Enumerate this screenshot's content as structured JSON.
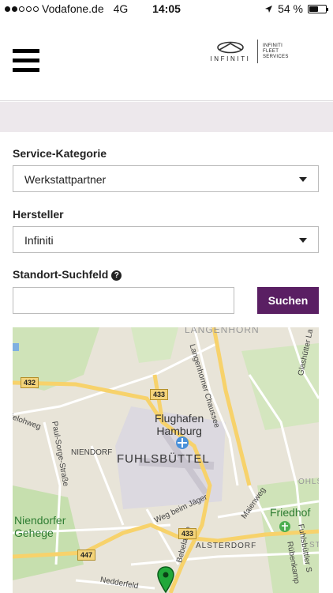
{
  "status_bar": {
    "carrier": "Vodafone.de",
    "network": "4G",
    "time": "14:05",
    "battery": "54 %",
    "battery_level": 0.54,
    "signal_bars": 2
  },
  "header": {
    "logo_brand": "INFINITI",
    "logo_text": [
      "INFINITI",
      "FLEET",
      "SERVICES"
    ]
  },
  "form": {
    "category_label": "Service-Kategorie",
    "category_value": "Werkstattpartner",
    "manufacturer_label": "Hersteller",
    "manufacturer_value": "Infiniti",
    "location_label": "Standort-Suchfeld",
    "help_glyph": "?",
    "location_value": "",
    "location_placeholder": "",
    "search_button": "Suchen"
  },
  "map": {
    "labels": {
      "langenhorn": "LANGENHORN",
      "langenhorner_chaussee": "Langenhorner Chaussee",
      "glashutter": "Glashütter La",
      "airport": "Flughafen\nHamburg",
      "fuhlsbuttel": "FUHLSBÜTTEL",
      "niendorf": "NIENDORF",
      "paul_sorge": "Paul-Sorge-Straße",
      "kielohweg": "ielohweg",
      "weg_beim_jager": "Weg beim Jäger",
      "maienweg": "Maienweg",
      "ohls": "OHLS",
      "friedhof": "Friedhof",
      "niendorfer_gehege": "Niendorfer\nGehege",
      "alsterdorf": "ALSTERDORF",
      "fuhlsbuttler_str": "Fuhlsbüttler S",
      "rubenkamp": "Rübenkamp",
      "nedderfeld": "Nedderfeld",
      "bebelallee": "Bebelallee",
      "st": "ST"
    },
    "roads": {
      "r432": "432",
      "r433a": "433",
      "r433b": "433",
      "r447": "447"
    }
  }
}
